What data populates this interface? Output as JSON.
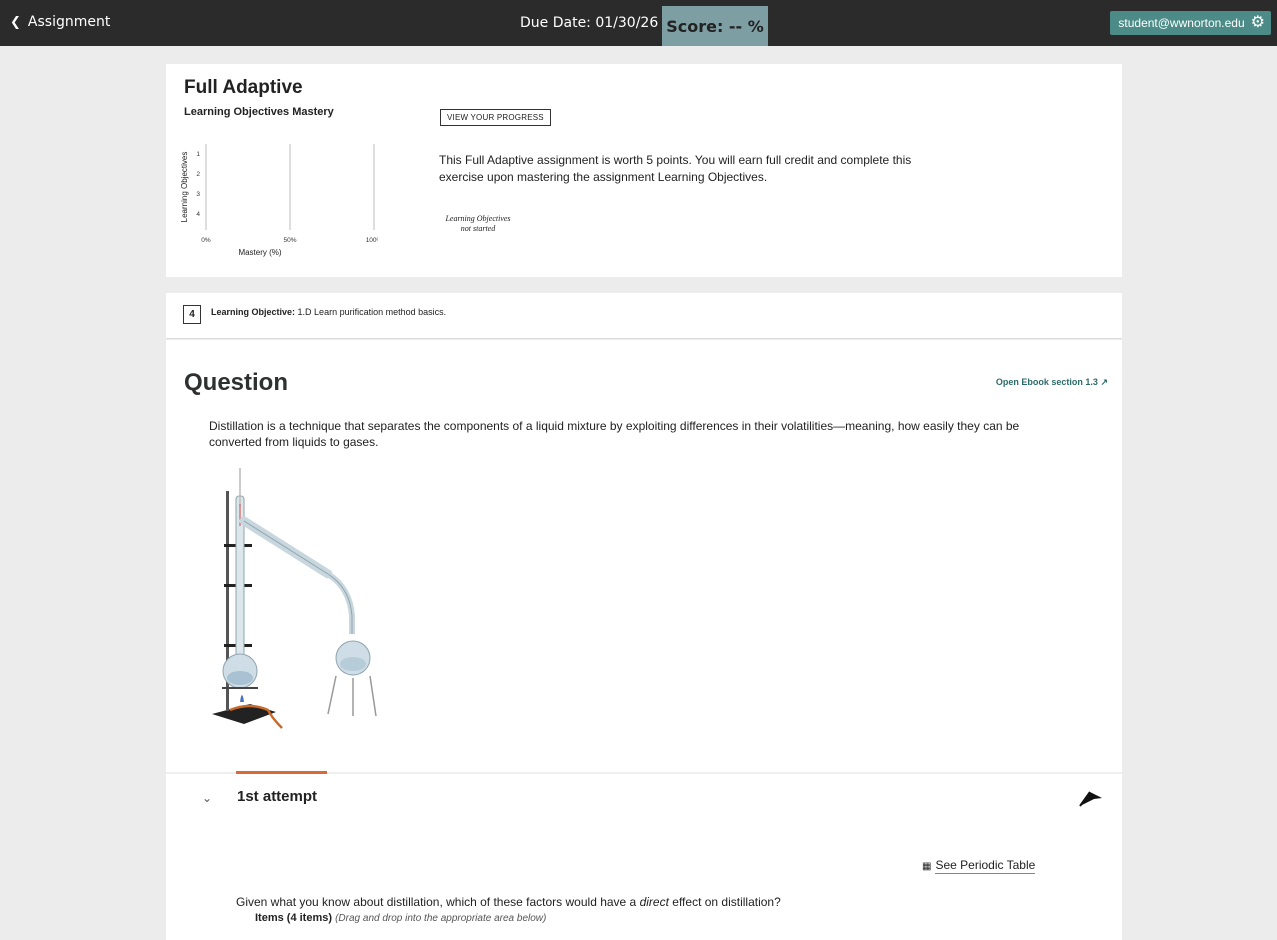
{
  "topbar": {
    "back_label": "Assignment",
    "due_date": "Due Date: 01/30/26",
    "score": "Score: -- %",
    "user_email": "student@wwnorton.edu"
  },
  "summary": {
    "title": "Full Adaptive",
    "subtitle": "Learning Objectives Mastery",
    "progress_button": "VIEW YOUR PROGRESS",
    "description": "This Full Adaptive assignment is worth 5 points. You will earn full credit and complete this exercise upon mastering the assignment Learning Objectives.",
    "status_line1": "Learning Objectives",
    "status_line2": "not started"
  },
  "chart_data": {
    "type": "bar",
    "orientation": "horizontal",
    "categories": [
      "1",
      "2",
      "3",
      "4"
    ],
    "values": [
      0,
      0,
      0,
      0
    ],
    "xlabel": "Mastery (%)",
    "ylabel": "Learning Objectives",
    "x_ticks": [
      "0%",
      "50%",
      "100%"
    ],
    "xlim": [
      0,
      100
    ],
    "grid": true
  },
  "objective": {
    "number": "4",
    "label": "Learning Objective:",
    "text": "1.D Learn purification method basics."
  },
  "question": {
    "title": "Question",
    "ebook_link": "Open Ebook section 1.3",
    "text": "Distillation is a technique that separates the components of a liquid mixture by exploiting differences in their volatilities—meaning, how easily they can be converted from liquids to gases."
  },
  "attempt": {
    "label": "1st attempt",
    "periodic_table": "See Periodic Table",
    "prompt_before": "Given what you know about distillation, which of these factors would have a",
    "prompt_emph": "direct",
    "prompt_after": "effect on distillation?",
    "items_label": "Items (4 items)",
    "items_hint": "(Drag and drop into the appropriate area below)"
  },
  "icons": {
    "back": "chevron-left-icon",
    "gear": "gear-icon",
    "external": "external-link-icon",
    "expand": "chevron-down-icon",
    "flag": "flag-icon",
    "periodic": "periodic-table-icon"
  },
  "colors": {
    "topbar": "#2b2b2b",
    "score_bg": "#7d9ea3",
    "user_bg": "#4c8b87",
    "accent": "#d9693b",
    "link": "#2d6b6a"
  }
}
